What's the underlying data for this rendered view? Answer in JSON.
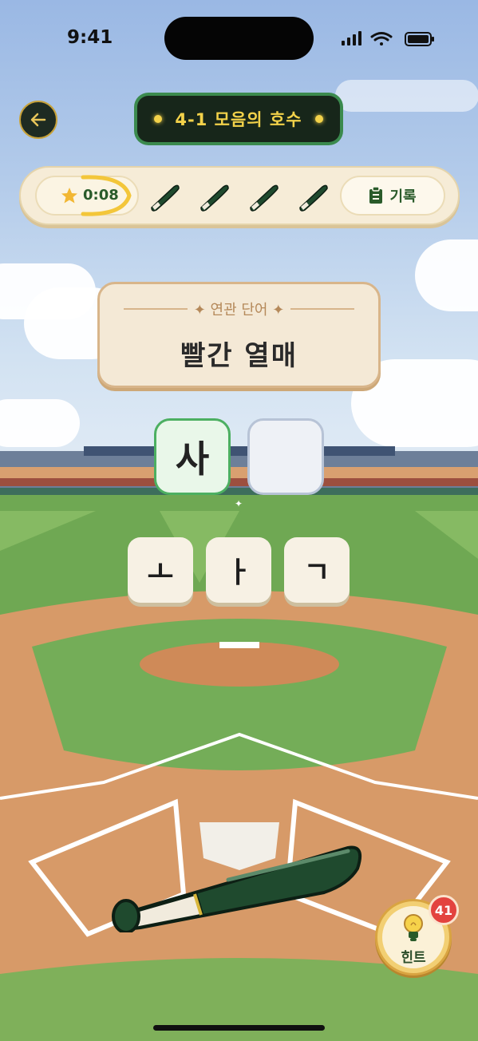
{
  "status_bar": {
    "time": "9:41"
  },
  "header": {
    "title": "4-1 모음의 호수"
  },
  "hud": {
    "timer": "0:08",
    "timer_progress": 0.35,
    "bats_remaining": 4,
    "record_label": "기록"
  },
  "word_card": {
    "label": "✦ 연관 단어 ✦",
    "word": "빨간 열매"
  },
  "answer": {
    "slots": [
      "사",
      ""
    ]
  },
  "jamo_tiles": [
    "ㅗ",
    "ㅏ",
    "ㄱ"
  ],
  "hint": {
    "label": "힌트",
    "count": "41"
  },
  "colors": {
    "accent_green": "#2a5b2a",
    "title_yellow": "#f3d24a",
    "badge_red": "#e3433f"
  }
}
